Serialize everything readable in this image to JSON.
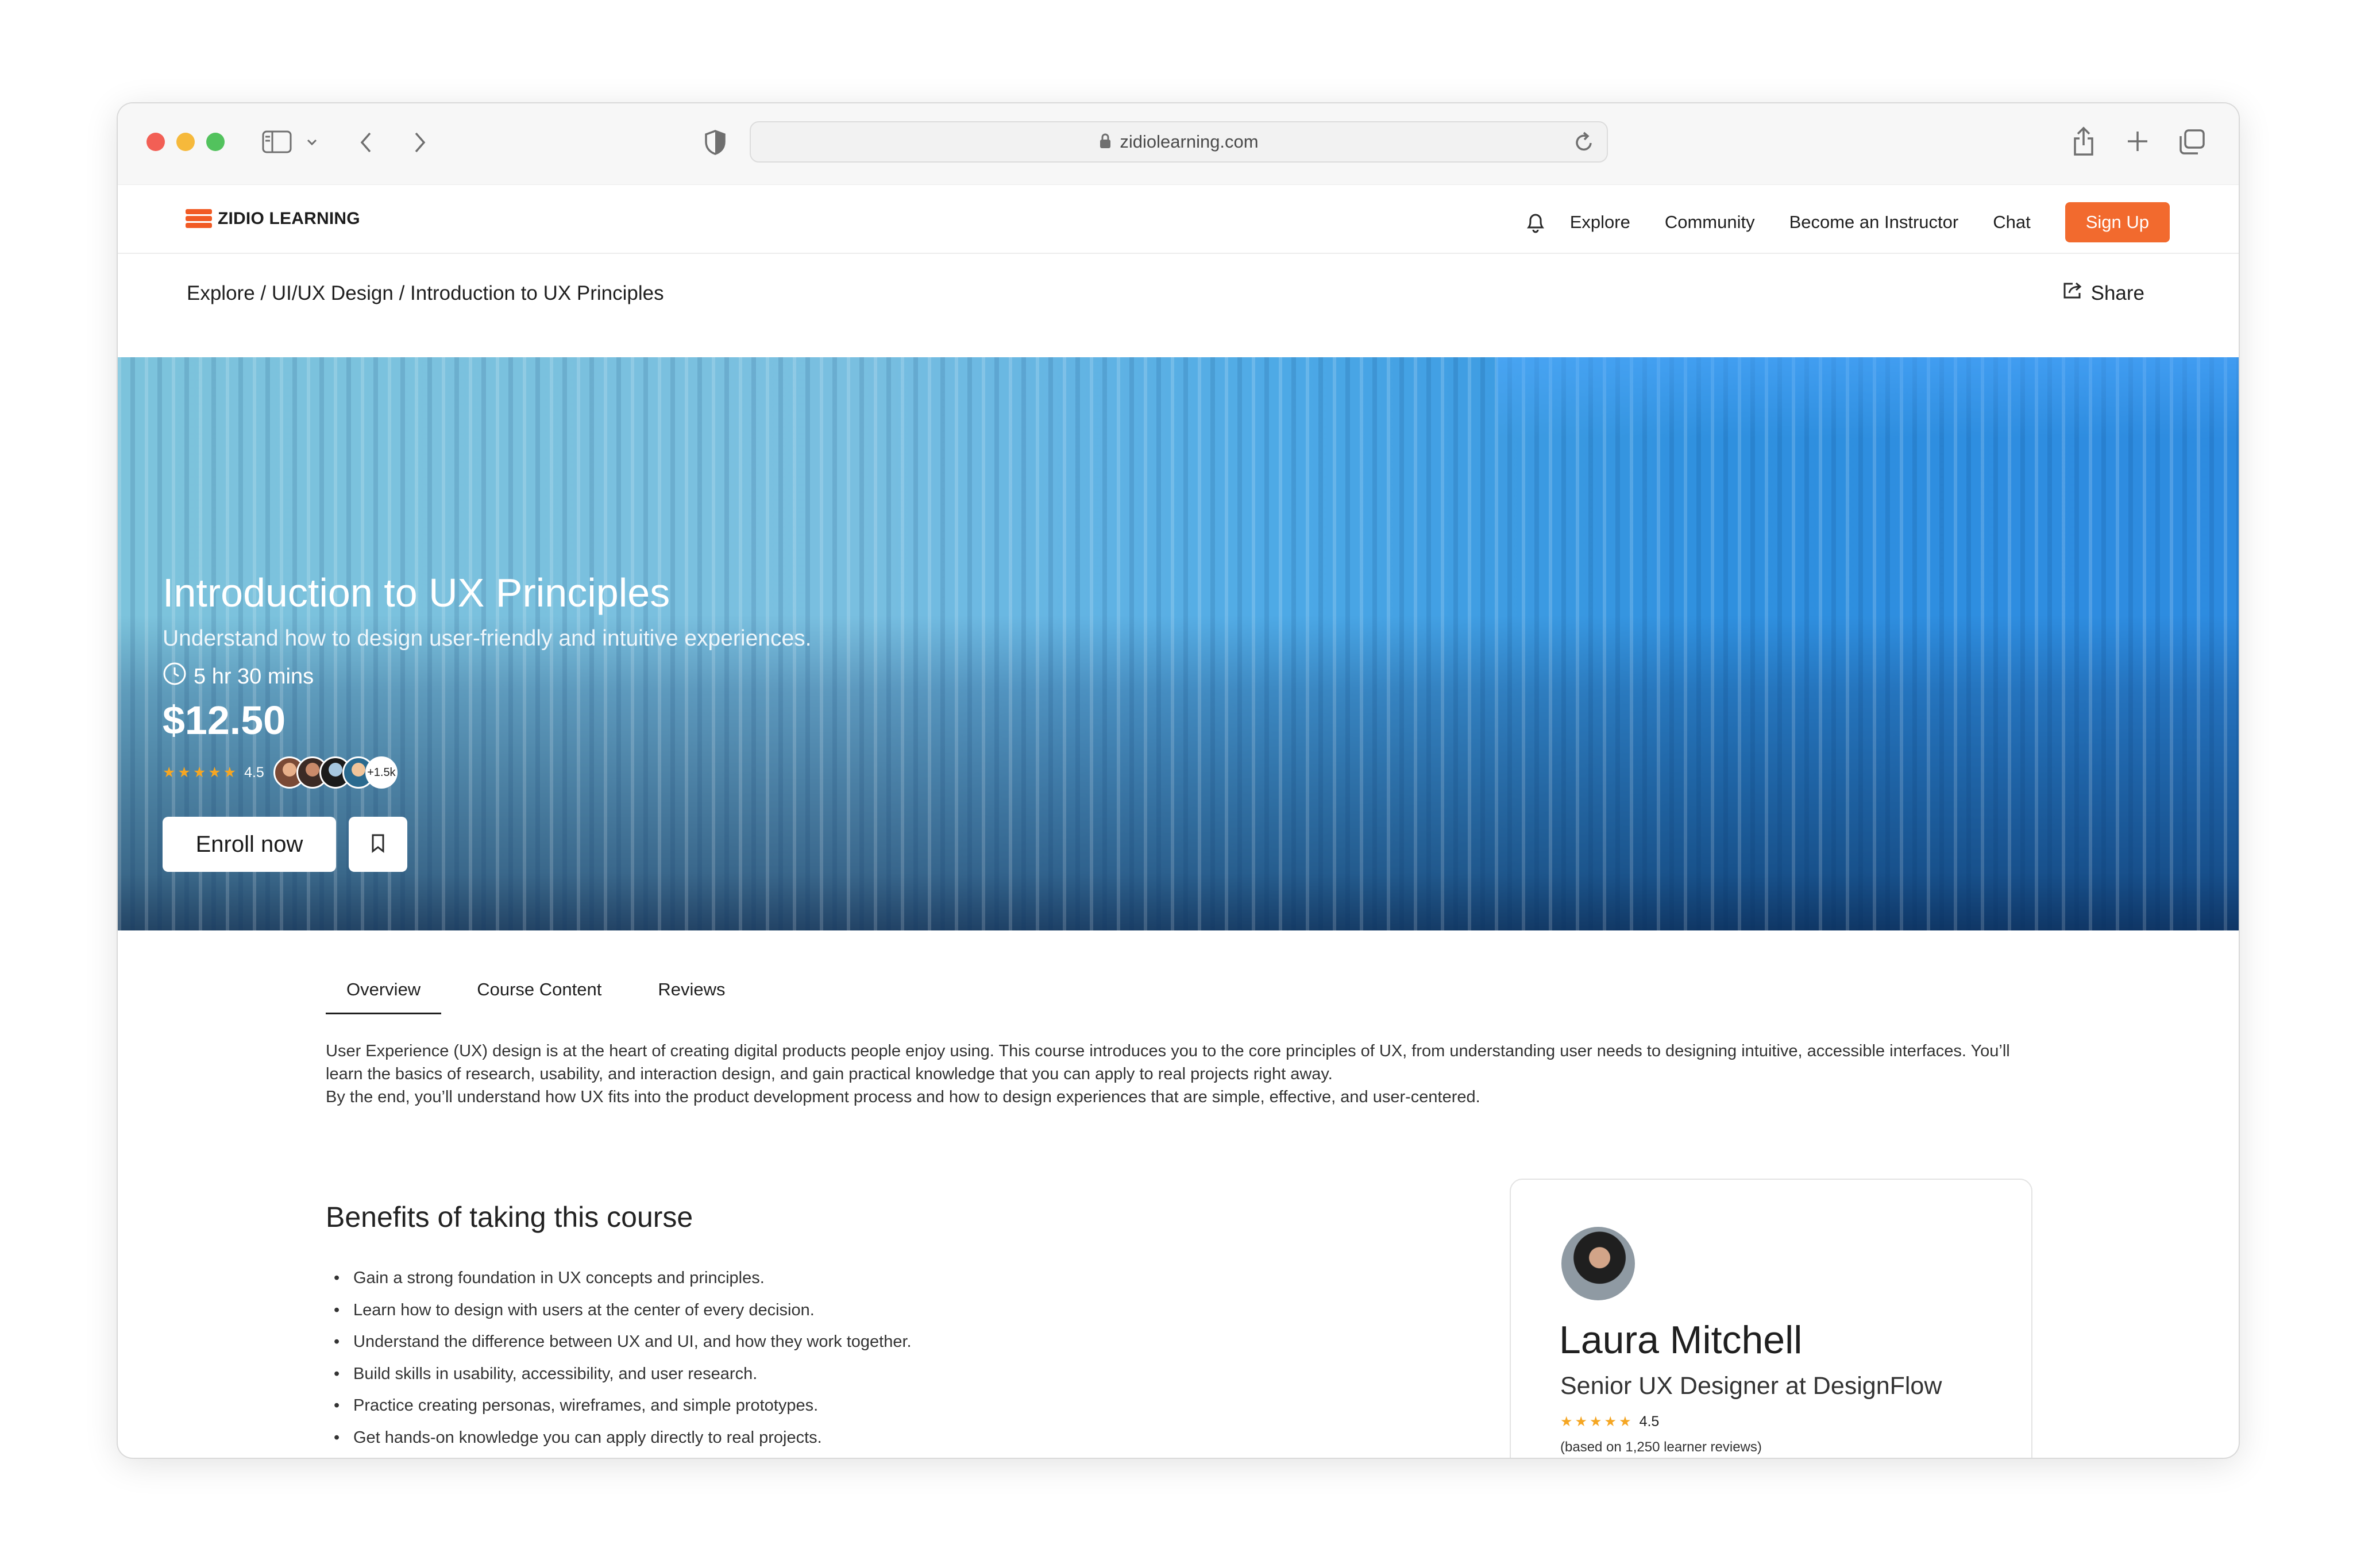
{
  "browser": {
    "url": "zidiolearning.com"
  },
  "header": {
    "logo_text": "ZIDIO LEARNING",
    "nav": [
      "Explore",
      "Community",
      "Become an Instructor",
      "Chat"
    ],
    "signup_label": "Sign Up",
    "accent_color": "#f26a2e"
  },
  "breadcrumb": {
    "text": "Explore / UI/UX Design / Introduction to UX Principles",
    "share_label": "Share"
  },
  "hero": {
    "title": "Introduction to UX Principles",
    "subtitle": "Understand how to design user-friendly and intuitive experiences.",
    "duration": "5 hr 30 mins",
    "price": "$12.50",
    "stars": "★★★★★",
    "rating": "4.5",
    "learners_more": "+1.5k",
    "enroll_label": "Enroll now"
  },
  "tabs": [
    "Overview",
    "Course Content",
    "Reviews"
  ],
  "overview": {
    "paragraph1": "User Experience (UX) design is at the heart of creating digital products people enjoy using. This course introduces you to the core principles of UX, from understanding user needs to designing intuitive, accessible interfaces. You’ll learn the basics of research, usability, and interaction design, and gain practical knowledge that you can apply to real projects right away.",
    "paragraph2": "By the end, you’ll understand how UX fits into the product development process and how to design experiences that are simple, effective, and user-centered."
  },
  "benefits": {
    "title": "Benefits of taking this course",
    "items": [
      "Gain a strong foundation in UX concepts and principles.",
      "Learn how to design with users at the center of every decision.",
      "Understand the difference between UX and UI, and how they work together.",
      "Build skills in usability, accessibility, and user research.",
      "Practice creating personas, wireframes, and simple prototypes.",
      "Get hands-on knowledge you can apply directly to real projects."
    ]
  },
  "instructor": {
    "name": "Laura Mitchell",
    "title": "Senior UX Designer at DesignFlow",
    "stars": "★★★★★",
    "rating": "4.5",
    "reviews": "(based on 1,250 learner reviews)"
  }
}
